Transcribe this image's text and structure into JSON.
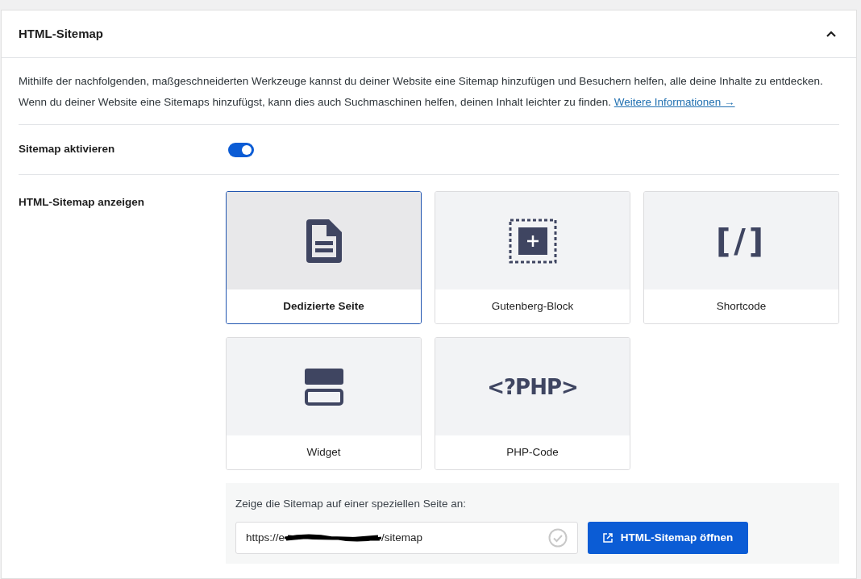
{
  "panel": {
    "title": "HTML-Sitemap",
    "expanded": true
  },
  "description": {
    "text": "Mithilfe der nachfolgenden, maßgeschneiderten Werkzeuge kannst du deiner Website eine Sitemap hinzufügen und Besuchern helfen, alle deine Inhalte zu entdecken. Wenn du deiner Website eine Sitemaps hinzufügst, kann dies auch Suchmaschinen helfen, deinen Inhalt leichter zu finden.",
    "link": "Weitere Informationen →"
  },
  "toggle_row": {
    "label": "Sitemap aktivieren",
    "on": true
  },
  "display_row": {
    "label": "HTML-Sitemap anzeigen",
    "options": [
      {
        "kind": "page",
        "label": "Dedizierte Seite",
        "selected": true
      },
      {
        "kind": "block",
        "label": "Gutenberg-Block",
        "selected": false
      },
      {
        "kind": "shortcode",
        "icon_text": "[/]",
        "label": "Shortcode",
        "selected": false
      },
      {
        "kind": "widget",
        "label": "Widget",
        "selected": false
      },
      {
        "kind": "php",
        "icon_text": "<?PHP>",
        "label": "PHP-Code",
        "selected": false
      }
    ]
  },
  "page_panel": {
    "prompt": "Zeige die Sitemap auf einer speziellen Seite an:",
    "url_start": "https://e",
    "url_end": "/sitemap",
    "button": "HTML-Sitemap öffnen"
  }
}
